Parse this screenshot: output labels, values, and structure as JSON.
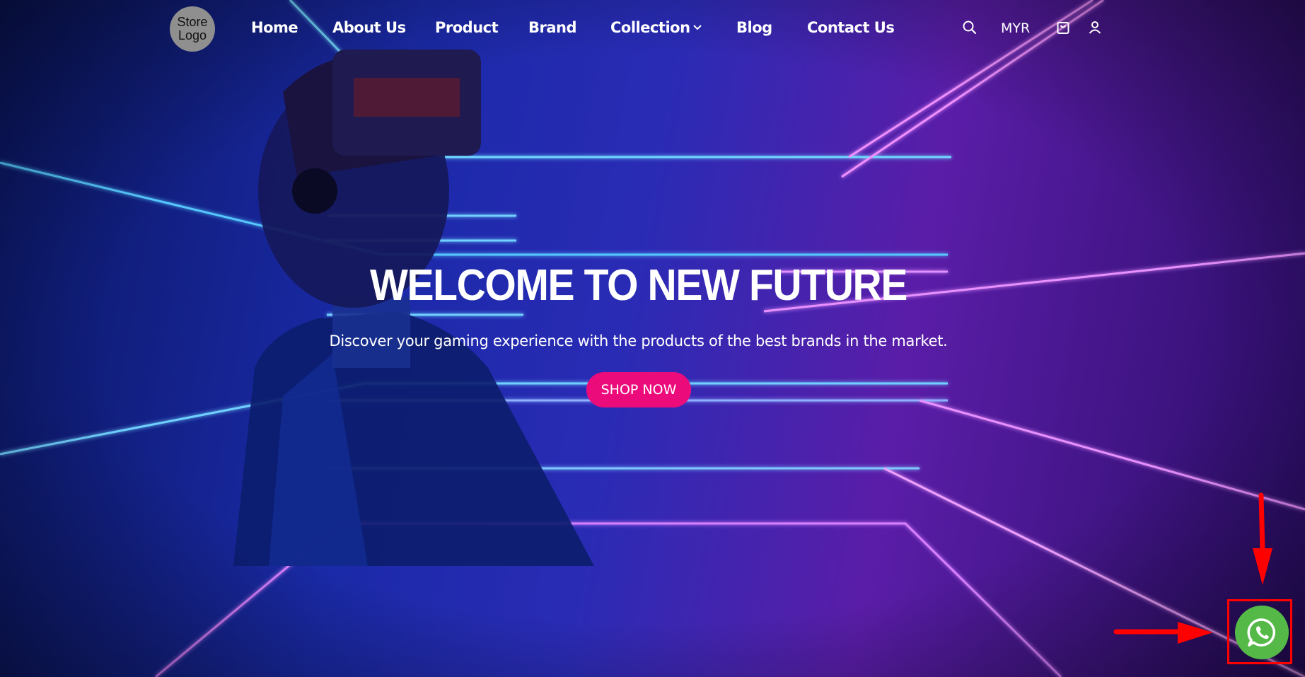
{
  "header": {
    "logo_text": "Store Logo",
    "nav": [
      {
        "label": "Home"
      },
      {
        "label": "About Us"
      },
      {
        "label": "Product"
      },
      {
        "label": "Brand"
      },
      {
        "label": "Collection",
        "has_dropdown": true
      },
      {
        "label": "Blog"
      },
      {
        "label": "Contact Us"
      }
    ],
    "currency": "MYR",
    "icons": [
      "search-icon",
      "shopping-bag-icon",
      "user-icon"
    ]
  },
  "hero": {
    "title": "WELCOME TO NEW FUTURE",
    "subtitle": "Discover your gaming experience with the products of the best brands in the market.",
    "cta_label": "SHOP NOW",
    "cta_color": "#ec0b7b"
  },
  "floating": {
    "whatsapp_icon": "whatsapp-icon",
    "whatsapp_color": "#55b948",
    "annotation_color": "#ff0000"
  }
}
